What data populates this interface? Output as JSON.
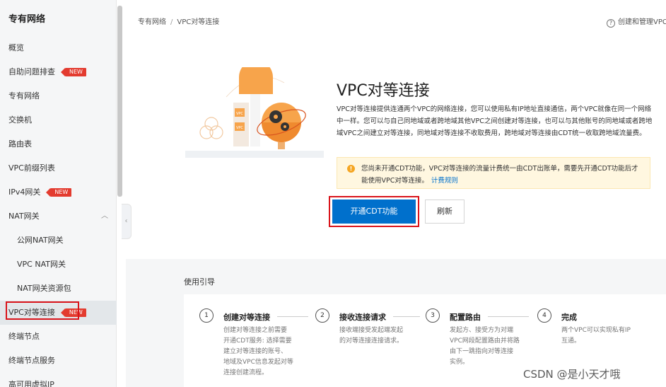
{
  "sidebar": {
    "title": "专有网络",
    "items": [
      {
        "label": "概览"
      },
      {
        "label": "自助问题排查",
        "badge": "NEW"
      },
      {
        "label": "专有网络"
      },
      {
        "label": "交换机"
      },
      {
        "label": "路由表"
      },
      {
        "label": "VPC前缀列表"
      },
      {
        "label": "IPv4网关",
        "badge": "NEW"
      },
      {
        "label": "NAT网关"
      },
      {
        "label": "公网NAT网关"
      },
      {
        "label": "VPC NAT网关"
      },
      {
        "label": "NAT网关资源包"
      },
      {
        "label": "VPC对等连接",
        "badge": "NEW"
      },
      {
        "label": "终端节点"
      },
      {
        "label": "终端节点服务"
      },
      {
        "label": "高可用虚拟IP"
      }
    ]
  },
  "header": {
    "breadcrumb": [
      "专有网络",
      "VPC对等连接"
    ],
    "breadcrumb_sep": "/",
    "help_text": "创建和管理VPC"
  },
  "hero": {
    "title": "VPC对等连接",
    "description": "VPC对等连接提供连通两个VPC的网络连接，您可以使用私有IP地址直接通信，两个VPC就像在同一个网络中一样。您可以与自己同地域或者跨地域其他VPC之间创建对等连接，也可以与其他账号的同地域或者跨地域VPC之间建立对等连接，同地域对等连接不收取费用，跨地域对等连接由CDT统一收取跨地域流量费。",
    "notice_text": "您尚未开通CDT功能，VPC对等连接的流量计费统一由CDT出账单，需要先开通CDT功能后才能使用VPC对等连接。",
    "notice_link": "计费规则",
    "primary_button": "开通CDT功能",
    "refresh_button": "刷新"
  },
  "guide": {
    "title": "使用引导",
    "steps": [
      {
        "num": "1",
        "title": "创建对等连接",
        "desc": [
          "创建对等连接之前需要",
          "开通CDT服务: 选择需要",
          "建立对等连接的账号、",
          "地域及VPC信息发起对等",
          "连接创建流程。"
        ]
      },
      {
        "num": "2",
        "title": "接收连接请求",
        "desc": [
          "接收端接受发起端发起",
          "的对等连接连接请求。"
        ]
      },
      {
        "num": "3",
        "title": "配置路由",
        "desc": [
          "发起方、接受方为对端",
          "VPC网段配置路由并将路",
          "由下一跳指向对等连接",
          "实例。"
        ]
      },
      {
        "num": "4",
        "title": "完成",
        "desc": [
          "两个VPC可以实现私有IP",
          "互通。"
        ]
      }
    ]
  },
  "watermark": "CSDN @是小天才哦",
  "colors": {
    "primary": "#0070cc",
    "badge": "#e33b2f",
    "highlight_box": "#d9141b",
    "notice_bg": "#fff7e0",
    "illustration_orange": "#f7a44b"
  },
  "icons": [
    "chevron-up-icon",
    "chevron-left-icon",
    "help-circle-icon",
    "warning-circle-icon",
    "gear-icon",
    "globe-icon"
  ]
}
